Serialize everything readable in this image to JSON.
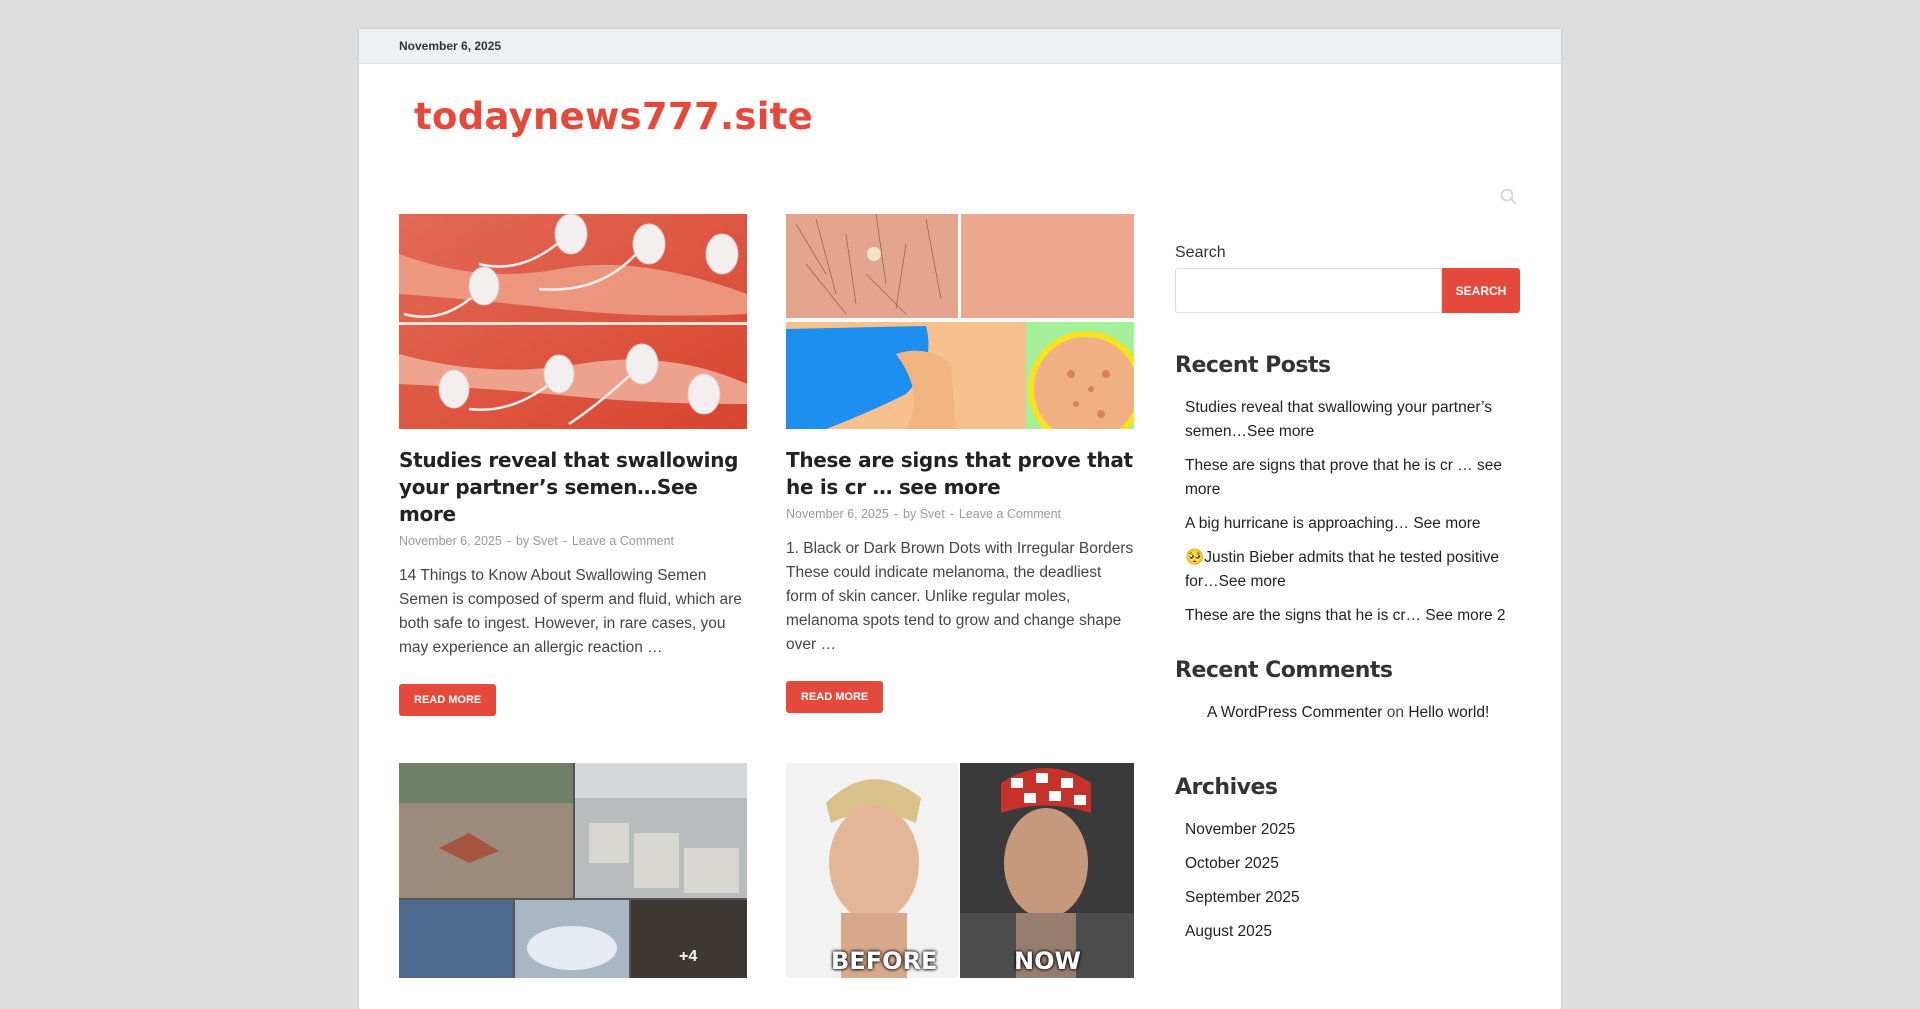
{
  "topbar": {
    "date": "November 6, 2025"
  },
  "header": {
    "site_title": "todaynews777.site"
  },
  "posts": [
    {
      "title": "Studies reveal that swallowing your partner’s semen…See more",
      "date": "November 6, 2025",
      "author_prefix": "by",
      "author": "Svet",
      "comment_link": "Leave a Comment",
      "excerpt": "14 Things to Know About Swallowing Semen Semen is composed of sperm and fluid, which are both safe to ingest. However, in rare cases, you may experience an allergic reaction …",
      "read_more": "READ MORE"
    },
    {
      "title": "These are signs that prove that he is cr … see more",
      "date": "November 6, 2025",
      "author_prefix": "by",
      "author": "Svet",
      "comment_link": "Leave a Comment",
      "excerpt": "1. Black or Dark Brown Dots with Irregular Borders These could indicate melanoma, the deadliest form of skin cancer. Unlike regular moles, melanoma spots tend to grow and change shape over …",
      "read_more": "READ MORE"
    },
    {
      "thumb_overlay": "+4"
    },
    {
      "thumb_left_label": "BEFORE",
      "thumb_right_label": "NOW"
    }
  ],
  "sidebar": {
    "search": {
      "label": "Search",
      "button": "SEARCH"
    },
    "recent_posts": {
      "title": "Recent Posts",
      "items": [
        "Studies reveal that swallowing your partner’s semen…See more",
        "These are signs that prove that he is cr … see more",
        "A big hurricane is approaching… See more",
        "🥺Justin Bieber admits that he tested positive for…See more",
        "These are the signs that he is cr… See more 2"
      ]
    },
    "recent_comments": {
      "title": "Recent Comments",
      "author": "A WordPress Commenter",
      "on": "on",
      "post": "Hello world!"
    },
    "archives": {
      "title": "Archives",
      "items": [
        "November 2025",
        "October 2025",
        "September 2025",
        "August 2025"
      ]
    }
  },
  "colors": {
    "accent": "#e4493c",
    "page_bg": "#dddddd",
    "topbar_bg": "#eef1f1"
  },
  "icons": {
    "search_toggle": "search-icon"
  }
}
